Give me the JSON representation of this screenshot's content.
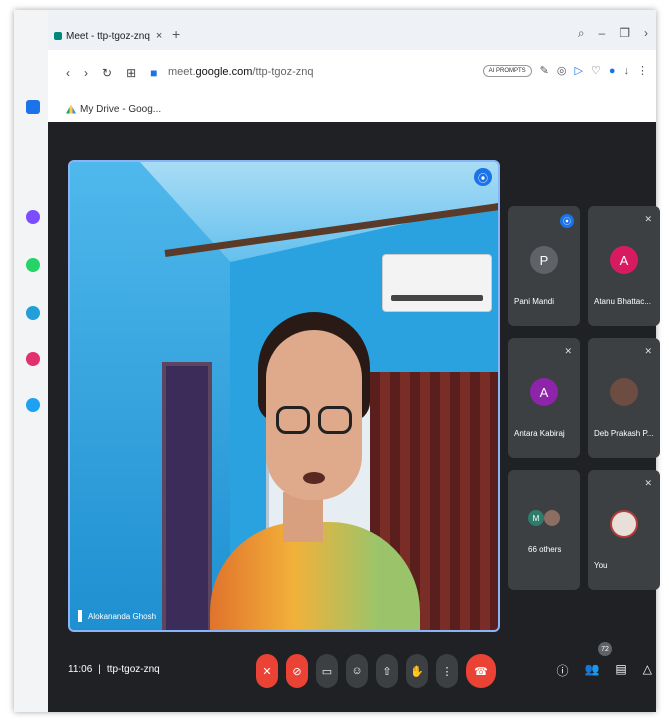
{
  "browser": {
    "tab_title": "Meet - ttp-tgoz-znq",
    "tab_close": "×",
    "new_tab": "+",
    "url_prefix": "meet.",
    "url_domain": "google.com",
    "url_path": "/ttp-tgoz-znq",
    "ai_prompts": "AI PROMPTS",
    "bookmark": "My Drive - Goog..."
  },
  "meet": {
    "main_speaker": "Alokananda Ghosh",
    "participants": [
      {
        "name": "Pani Mandi",
        "initial": "P",
        "color": "#5f6368"
      },
      {
        "name": "Atanu Bhattac...",
        "initial": "A",
        "color": "#d81b60"
      },
      {
        "name": "Antara Kabiraj",
        "initial": "A",
        "color": "#8e24aa"
      },
      {
        "name": "Deb Prakash P...",
        "initial": "",
        "color": "#6d4c41"
      },
      {
        "name": "66 others",
        "initial": "M",
        "color": "#2e7d6b"
      },
      {
        "name": "You",
        "initial": "",
        "color": "#e8e0d8"
      }
    ],
    "time": "11:06",
    "meeting_code": "ttp-tgoz-znq",
    "participant_count": "72"
  },
  "icons": {
    "mic_off": "mic-off-icon",
    "camera_off": "camera-off-icon",
    "captions": "captions-icon",
    "emoji": "emoji-icon",
    "present": "present-icon",
    "raise_hand": "raise-hand-icon",
    "more": "more-icon",
    "end_call": "end-call-icon"
  }
}
